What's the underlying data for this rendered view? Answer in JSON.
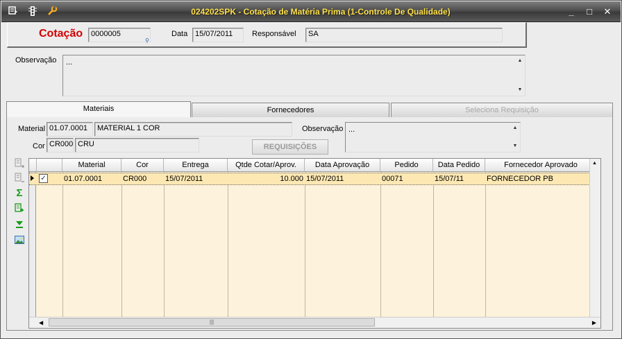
{
  "window": {
    "title": "024202SPK - Cotação de Matéria Prima (1-Controle De Qualidade)",
    "icons": [
      "menu-icon",
      "traffic-light-icon",
      "wrench-icon"
    ],
    "controls": {
      "minimize": "_",
      "maximize": "□",
      "close": "✕"
    }
  },
  "header": {
    "cotacao_label": "Cotação",
    "cotacao_value": "0000005",
    "data_label": "Data",
    "data_value": "15/07/2011",
    "responsavel_label": "Responsável",
    "responsavel_value": "SA",
    "observacao_label": "Observação",
    "observacao_value": "..."
  },
  "tabs": [
    {
      "label": "Materiais",
      "state": "active"
    },
    {
      "label": "Fornecedores",
      "state": "normal"
    },
    {
      "label": "Seleciona Requisição",
      "state": "disabled"
    }
  ],
  "materiais": {
    "material_label": "Material",
    "material_code": "01.07.0001",
    "material_name": "MATERIAL 1 COR",
    "cor_label": "Cor",
    "cor_code": "CR000",
    "cor_name": "CRU",
    "observacao_label": "Observação",
    "observacao_value": "...",
    "requisicoes_button": "REQUISIÇÕES"
  },
  "side_toolbar": [
    "add-row-icon",
    "remove-row-icon",
    "sum-icon",
    "export-icon",
    "download-icon",
    "image-icon"
  ],
  "grid": {
    "columns": [
      "Material",
      "Cor",
      "Entrega",
      "Qtde Cotar/Aprov.",
      "Data Aprovação",
      "Pedido",
      "Data Pedido",
      "Fornecedor Aprovado"
    ],
    "rows": [
      {
        "checked": true,
        "cells": [
          "01.07.0001",
          "CR000",
          "15/07/2011",
          "10.000",
          "15/07/2011",
          "00071",
          "15/07/11",
          "FORNECEDOR PB"
        ]
      }
    ],
    "hscroll_thumb": "|||"
  },
  "colors": {
    "title_text": "#ffe14a",
    "cotacao_label": "#d40000",
    "grid_background": "#fdf3dc",
    "selected_row": "#fde8b4",
    "sum_icon": "#1a9a1a"
  }
}
